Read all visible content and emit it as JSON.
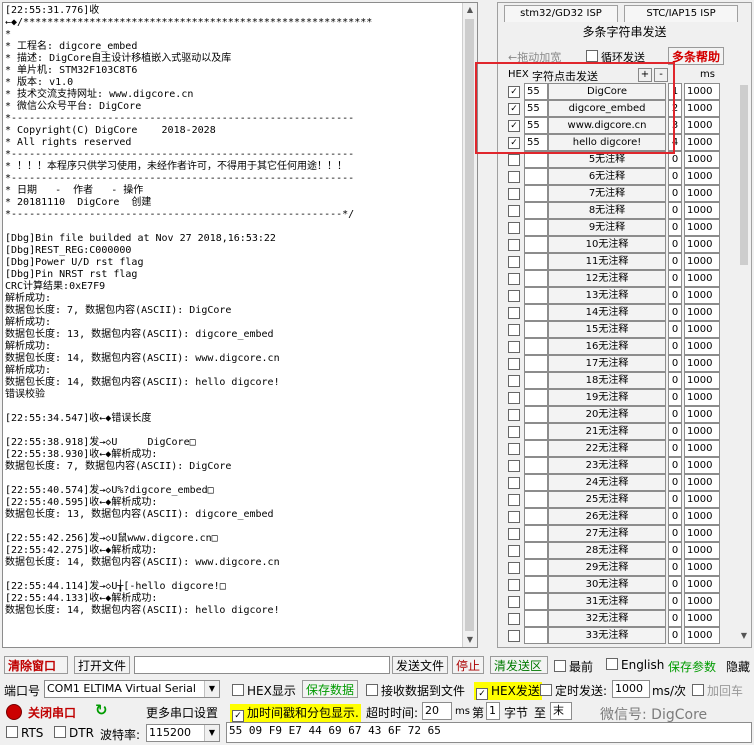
{
  "rx": {
    "text": "[22:55:31.776]收\n←◆/**********************************************************\n*\n* 工程名: digcore_embed\n* 描述: DigCore自主设计移植嵌入式驱动以及库\n* 单片机: STM32F103C8T6\n* 版本: v1.0\n* 技术交流支持网址: www.digcore.cn\n* 微信公众号平台: DigCore\n*---------------------------------------------------------\n* Copyright(C) DigCore    2018-2028\n* All rights reserved\n*---------------------------------------------------------\n* ！！！本程序只供学习使用，未经作者许可，不得用于其它任何用途！！！\n*---------------------------------------------------------\n* 日期   -  作者   - 操作\n* 20181110  DigCore  创建\n*-------------------------------------------------------*/\n\n[Dbg]Bin file builded at Nov 27 2018,16:53:22\n[Dbg]REST_REG:C000000\n[Dbg]Power U/D rst flag\n[Dbg]Pin NRST rst flag\nCRC计算结果:0xE7F9\n解析成功:\n数据包长度: 7, 数据包内容(ASCII): DigCore\n解析成功:\n数据包长度: 13, 数据包内容(ASCII): digcore_embed\n解析成功:\n数据包长度: 14, 数据包内容(ASCII): www.digcore.cn\n解析成功:\n数据包长度: 14, 数据包内容(ASCII): hello digcore!\n错误校验\n\n[22:55:34.547]收←◆错误长度\n\n[22:55:38.918]发→◇U     DigCore□\n[22:55:38.930]收←◆解析成功:\n数据包长度: 7, 数据包内容(ASCII): DigCore\n\n[22:55:40.574]发→◇U%?digcore_embed□\n[22:55:40.595]收←◆解析成功:\n数据包长度: 13, 数据包内容(ASCII): digcore_embed\n\n[22:55:42.256]发→◇U鼠www.digcore.cn□\n[22:55:42.275]收←◆解析成功:\n数据包长度: 14, 数据包内容(ASCII): www.digcore.cn\n\n[22:55:44.114]发→◇U╁[-hello digcore!□\n[22:55:44.133]收←◆解析成功:\n数据包长度: 14, 数据包内容(ASCII): hello digcore!"
  },
  "panel": {
    "tab1": "stm32/GD32 ISP",
    "tab2": "STC/IAP15 ISP",
    "title": "多条字符串发送",
    "drag_label": "←拖动加宽",
    "loop_label": "循环发送",
    "help_label": "多条帮助",
    "hdr_hex": "HEX",
    "hdr_str": "字符点击发送",
    "hdr_ms": "ms",
    "plus": "+",
    "minus": "-",
    "rows": [
      {
        "checked": true,
        "hex": "55",
        "label": "DigCore",
        "num": "1",
        "ms": "1000"
      },
      {
        "checked": true,
        "hex": "55",
        "label": "digcore_embed",
        "num": "2",
        "ms": "1000"
      },
      {
        "checked": true,
        "hex": "55",
        "label": "www.digcore.cn",
        "num": "3",
        "ms": "1000"
      },
      {
        "checked": true,
        "hex": "55",
        "label": "hello digcore!",
        "num": "4",
        "ms": "1000"
      },
      {
        "checked": false,
        "hex": "",
        "label": "5无注释",
        "num": "0",
        "ms": "1000"
      },
      {
        "checked": false,
        "hex": "",
        "label": "6无注释",
        "num": "0",
        "ms": "1000"
      },
      {
        "checked": false,
        "hex": "",
        "label": "7无注释",
        "num": "0",
        "ms": "1000"
      },
      {
        "checked": false,
        "hex": "",
        "label": "8无注释",
        "num": "0",
        "ms": "1000"
      },
      {
        "checked": false,
        "hex": "",
        "label": "9无注释",
        "num": "0",
        "ms": "1000"
      },
      {
        "checked": false,
        "hex": "",
        "label": "10无注释",
        "num": "0",
        "ms": "1000"
      },
      {
        "checked": false,
        "hex": "",
        "label": "11无注释",
        "num": "0",
        "ms": "1000"
      },
      {
        "checked": false,
        "hex": "",
        "label": "12无注释",
        "num": "0",
        "ms": "1000"
      },
      {
        "checked": false,
        "hex": "",
        "label": "13无注释",
        "num": "0",
        "ms": "1000"
      },
      {
        "checked": false,
        "hex": "",
        "label": "14无注释",
        "num": "0",
        "ms": "1000"
      },
      {
        "checked": false,
        "hex": "",
        "label": "15无注释",
        "num": "0",
        "ms": "1000"
      },
      {
        "checked": false,
        "hex": "",
        "label": "16无注释",
        "num": "0",
        "ms": "1000"
      },
      {
        "checked": false,
        "hex": "",
        "label": "17无注释",
        "num": "0",
        "ms": "1000"
      },
      {
        "checked": false,
        "hex": "",
        "label": "18无注释",
        "num": "0",
        "ms": "1000"
      },
      {
        "checked": false,
        "hex": "",
        "label": "19无注释",
        "num": "0",
        "ms": "1000"
      },
      {
        "checked": false,
        "hex": "",
        "label": "20无注释",
        "num": "0",
        "ms": "1000"
      },
      {
        "checked": false,
        "hex": "",
        "label": "21无注释",
        "num": "0",
        "ms": "1000"
      },
      {
        "checked": false,
        "hex": "",
        "label": "22无注释",
        "num": "0",
        "ms": "1000"
      },
      {
        "checked": false,
        "hex": "",
        "label": "23无注释",
        "num": "0",
        "ms": "1000"
      },
      {
        "checked": false,
        "hex": "",
        "label": "24无注释",
        "num": "0",
        "ms": "1000"
      },
      {
        "checked": false,
        "hex": "",
        "label": "25无注释",
        "num": "0",
        "ms": "1000"
      },
      {
        "checked": false,
        "hex": "",
        "label": "26无注释",
        "num": "0",
        "ms": "1000"
      },
      {
        "checked": false,
        "hex": "",
        "label": "27无注释",
        "num": "0",
        "ms": "1000"
      },
      {
        "checked": false,
        "hex": "",
        "label": "28无注释",
        "num": "0",
        "ms": "1000"
      },
      {
        "checked": false,
        "hex": "",
        "label": "29无注释",
        "num": "0",
        "ms": "1000"
      },
      {
        "checked": false,
        "hex": "",
        "label": "30无注释",
        "num": "0",
        "ms": "1000"
      },
      {
        "checked": false,
        "hex": "",
        "label": "31无注释",
        "num": "0",
        "ms": "1000"
      },
      {
        "checked": false,
        "hex": "",
        "label": "32无注释",
        "num": "0",
        "ms": "1000"
      },
      {
        "checked": false,
        "hex": "",
        "label": "33无注释",
        "num": "0",
        "ms": "1000"
      }
    ]
  },
  "toolbar1": {
    "clear_window": "清除窗口",
    "open_file": "打开文件",
    "send_file": "发送文件",
    "stop": "停止",
    "clear_send": "清发送区",
    "topmost": "最前",
    "english": "English",
    "save_params": "保存参数",
    "hide": "隐藏"
  },
  "toolbar2": {
    "port_label": "端口号",
    "port_value": "COM1 ELTIMA Virtual Serial",
    "hex_display": "HEX显示",
    "save_data": "保存数据",
    "recv_to_file": "接收数据到文件",
    "hex_send": "HEX发送",
    "timed_send": "定时发送:",
    "timed_ms": "1000",
    "ms_per": "ms/次",
    "add_cr": "加回车"
  },
  "toolbar3": {
    "close_port": "关闭串口",
    "more_settings": "更多串口设置",
    "timestamp": "加时间戳和分包显示.",
    "timeout_label": "超时时间:",
    "timeout_value": "20",
    "ms": "ms",
    "nth": "第",
    "byte_from": "1",
    "byte": "字节",
    "to": "至",
    "end": "末"
  },
  "toolbar4": {
    "rts": "RTS",
    "dtr": "DTR",
    "baud_label": "波特率:",
    "baud_value": "115200",
    "send_hex": "55 09 F9 E7 44 69 67 43 6F 72 65"
  },
  "watermark": "微信号: DigCore",
  "colors": {
    "accent_red": "#e0262c",
    "highlight_yellow": "#ffff00",
    "green": "#009b00"
  }
}
